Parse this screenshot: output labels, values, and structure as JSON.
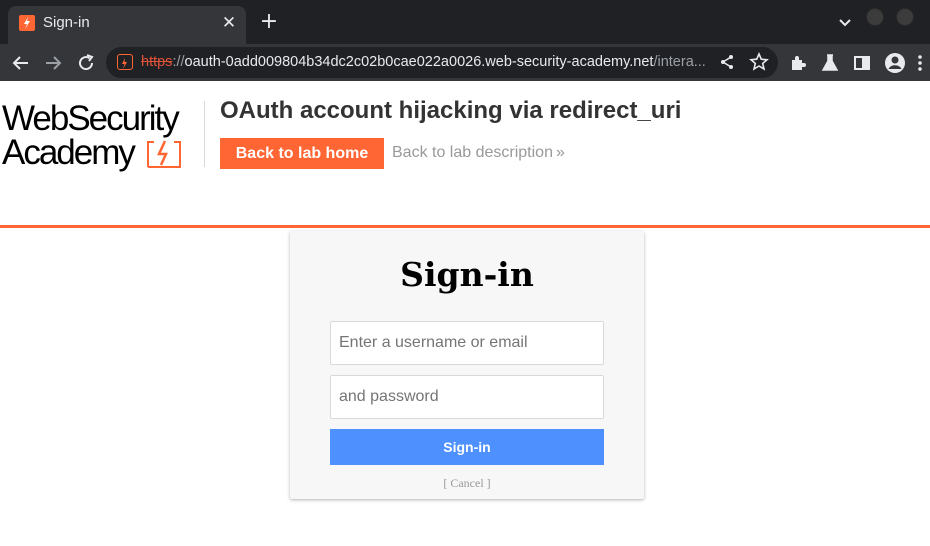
{
  "browser": {
    "tab_title": "Sign-in",
    "tab_close": "✕",
    "new_tab": "+",
    "url_scheme": "https",
    "url_sep": "://",
    "url_host": "oauth-0add009804b34dc2c02b0cae022a0026.web-security-academy.net",
    "url_path": "/intera..."
  },
  "header": {
    "logo_line1": "WebSecurity",
    "logo_line2": "Academy",
    "lab_title": "OAuth account hijacking via redirect_uri",
    "back_home_label": "Back to lab home",
    "back_description_label": "Back to lab description",
    "back_description_chevron": "»"
  },
  "login": {
    "title": "Sign-in",
    "username_placeholder": "Enter a username or email",
    "password_placeholder": "and password",
    "submit_label": "Sign-in",
    "cancel_label": "[ Cancel ]"
  },
  "colors": {
    "brand_orange": "#ff6633",
    "button_blue": "#4d90fe",
    "chrome_dark": "#202124",
    "chrome_toolbar": "#35363a"
  }
}
